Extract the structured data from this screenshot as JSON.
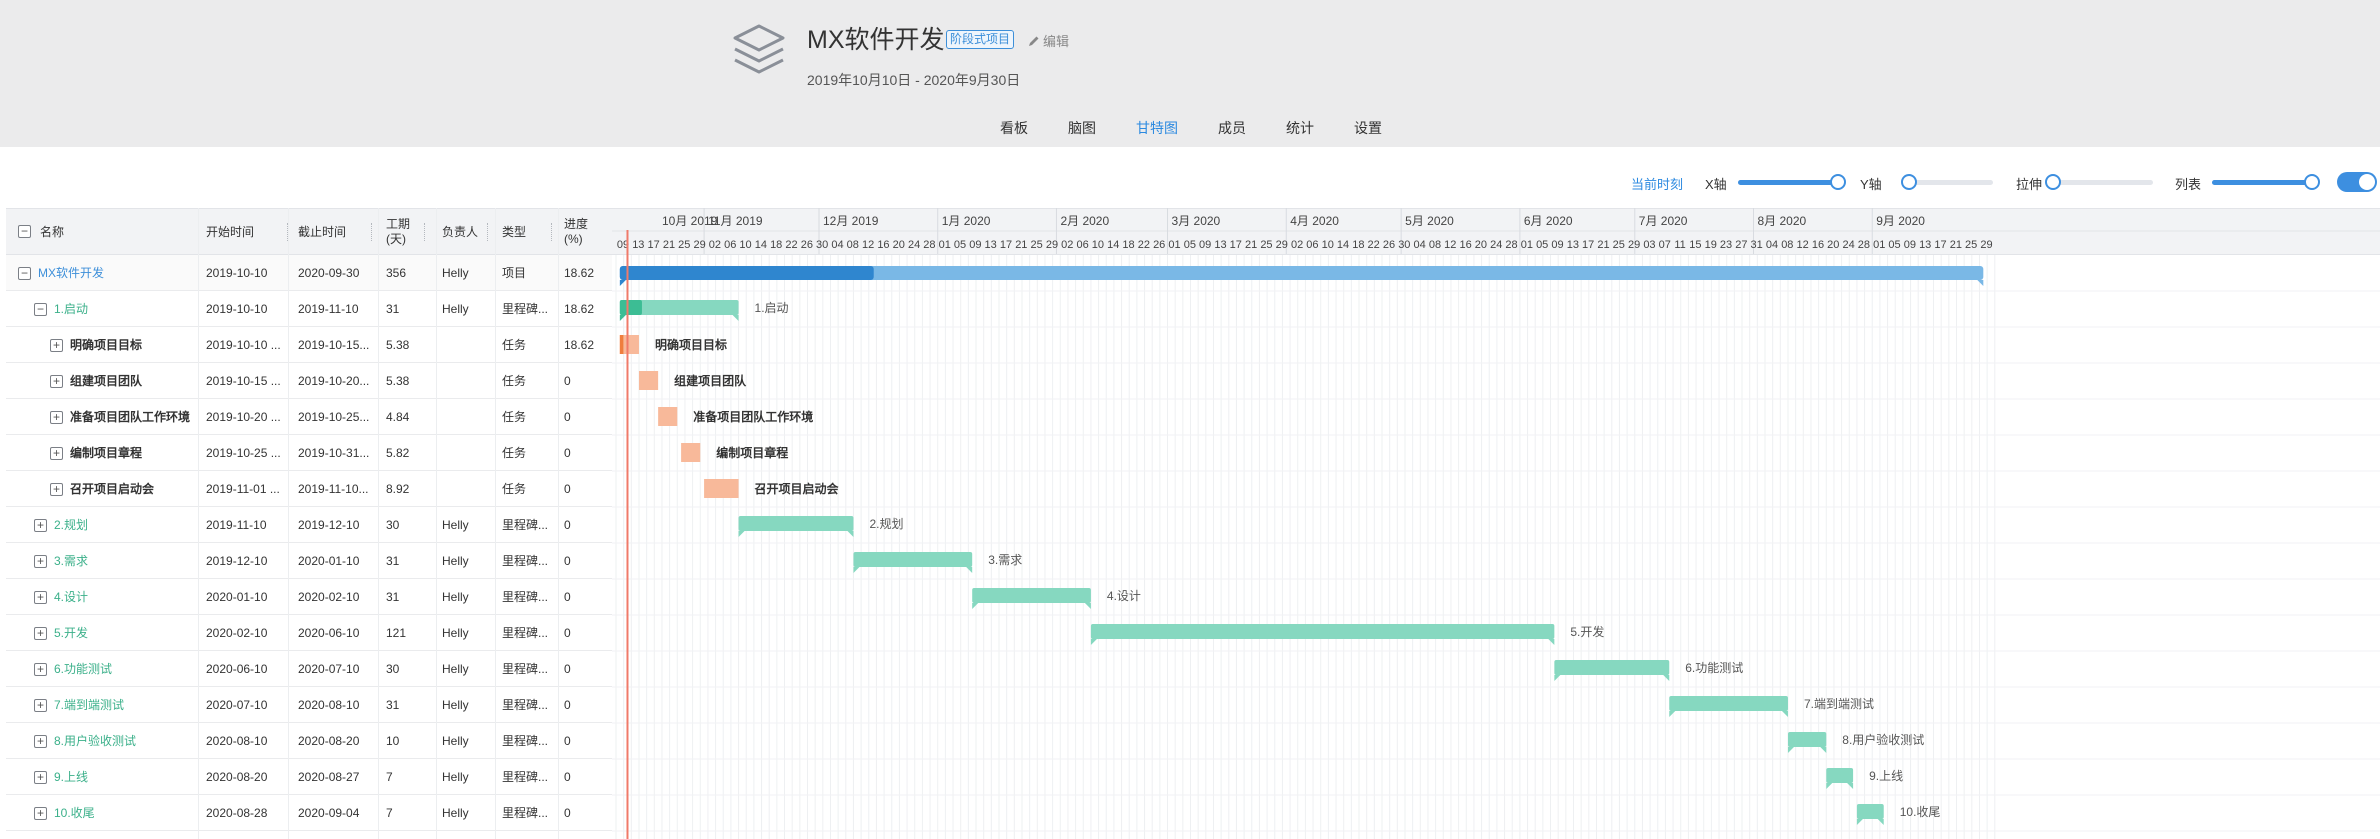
{
  "project": {
    "title": "MX软件开发",
    "tag": "阶段式项目",
    "edit_label": "编辑",
    "date_range": "2019年10月10日 - 2020年9月30日"
  },
  "tabs": [
    {
      "label": "看板",
      "active": false
    },
    {
      "label": "脑图",
      "active": false
    },
    {
      "label": "甘特图",
      "active": true
    },
    {
      "label": "成员",
      "active": false
    },
    {
      "label": "统计",
      "active": false
    },
    {
      "label": "设置",
      "active": false
    }
  ],
  "toolbar": {
    "now_label": "当前时刻",
    "x_axis_label": "X轴",
    "y_axis_label": "Y轴",
    "stretch_label": "拉伸",
    "list_label": "列表",
    "x_axis_level": 1.0,
    "y_axis_level": 0.0,
    "stretch_level": 0.0,
    "list_level": 1.0,
    "list_toggle_on": true
  },
  "colors": {
    "accent": "#2c8ae0",
    "project_bar": "#7ab8e6",
    "project_progress": "#2f86cf",
    "milestone_bar": "#86d8c0",
    "milestone_progress": "#3cbd94",
    "task_bar": "#f8b99a",
    "task_progress": "#ef7e3e",
    "today_line": "#f07a6a"
  },
  "columns": {
    "name": "名称",
    "start": "开始时间",
    "end": "截止时间",
    "duration": "工期(天)",
    "owner": "负责人",
    "type": "类型",
    "progress": "进度(%)"
  },
  "rows": [
    {
      "name": "MX软件开发",
      "start": "2019-10-10",
      "end": "2020-09-30",
      "duration": "356",
      "owner": "Helly",
      "type": "项目",
      "progress": "18.62",
      "kind": "project",
      "level": 0,
      "toggle": "−",
      "bar_start": "2019-10-10",
      "bar_end": "2020-09-30",
      "pct": 18.62
    },
    {
      "name": "1.启动",
      "start": "2019-10-10",
      "end": "2019-11-10",
      "duration": "31",
      "owner": "Helly",
      "type": "里程碑...",
      "progress": "18.62",
      "kind": "milestone",
      "level": 1,
      "toggle": "−",
      "bar_start": "2019-10-10",
      "bar_end": "2019-11-10",
      "pct": 18.62
    },
    {
      "name": "明确项目目标",
      "start": "2019-10-10 ...",
      "end": "2019-10-15...",
      "duration": "5.38",
      "owner": "",
      "type": "任务",
      "progress": "18.62",
      "kind": "task",
      "level": 2,
      "toggle": "+",
      "bar_start": "2019-10-10",
      "bar_end": "2019-10-15",
      "pct": 18.62
    },
    {
      "name": "组建项目团队",
      "start": "2019-10-15 ...",
      "end": "2019-10-20...",
      "duration": "5.38",
      "owner": "",
      "type": "任务",
      "progress": "0",
      "kind": "task",
      "level": 2,
      "toggle": "+",
      "bar_start": "2019-10-15",
      "bar_end": "2019-10-20",
      "pct": 0
    },
    {
      "name": "准备项目团队工作环境",
      "start": "2019-10-20 ...",
      "end": "2019-10-25...",
      "duration": "4.84",
      "owner": "",
      "type": "任务",
      "progress": "0",
      "kind": "task",
      "level": 2,
      "toggle": "+",
      "bar_start": "2019-10-20",
      "bar_end": "2019-10-25",
      "pct": 0
    },
    {
      "name": "编制项目章程",
      "start": "2019-10-25 ...",
      "end": "2019-10-31...",
      "duration": "5.82",
      "owner": "",
      "type": "任务",
      "progress": "0",
      "kind": "task",
      "level": 2,
      "toggle": "+",
      "bar_start": "2019-10-26",
      "bar_end": "2019-10-31",
      "pct": 0
    },
    {
      "name": "召开项目启动会",
      "start": "2019-11-01 ...",
      "end": "2019-11-10...",
      "duration": "8.92",
      "owner": "",
      "type": "任务",
      "progress": "0",
      "kind": "task",
      "level": 2,
      "toggle": "+",
      "bar_start": "2019-11-01",
      "bar_end": "2019-11-10",
      "pct": 0
    },
    {
      "name": "2.规划",
      "start": "2019-11-10",
      "end": "2019-12-10",
      "duration": "30",
      "owner": "Helly",
      "type": "里程碑...",
      "progress": "0",
      "kind": "milestone",
      "level": 1,
      "toggle": "+",
      "bar_start": "2019-11-10",
      "bar_end": "2019-12-10",
      "pct": 0
    },
    {
      "name": "3.需求",
      "start": "2019-12-10",
      "end": "2020-01-10",
      "duration": "31",
      "owner": "Helly",
      "type": "里程碑...",
      "progress": "0",
      "kind": "milestone",
      "level": 1,
      "toggle": "+",
      "bar_start": "2019-12-10",
      "bar_end": "2020-01-10",
      "pct": 0
    },
    {
      "name": "4.设计",
      "start": "2020-01-10",
      "end": "2020-02-10",
      "duration": "31",
      "owner": "Helly",
      "type": "里程碑...",
      "progress": "0",
      "kind": "milestone",
      "level": 1,
      "toggle": "+",
      "bar_start": "2020-01-10",
      "bar_end": "2020-02-10",
      "pct": 0
    },
    {
      "name": "5.开发",
      "start": "2020-02-10",
      "end": "2020-06-10",
      "duration": "121",
      "owner": "Helly",
      "type": "里程碑...",
      "progress": "0",
      "kind": "milestone",
      "level": 1,
      "toggle": "+",
      "bar_start": "2020-02-10",
      "bar_end": "2020-06-10",
      "pct": 0
    },
    {
      "name": "6.功能测试",
      "start": "2020-06-10",
      "end": "2020-07-10",
      "duration": "30",
      "owner": "Helly",
      "type": "里程碑...",
      "progress": "0",
      "kind": "milestone",
      "level": 1,
      "toggle": "+",
      "bar_start": "2020-06-10",
      "bar_end": "2020-07-10",
      "pct": 0
    },
    {
      "name": "7.端到端测试",
      "start": "2020-07-10",
      "end": "2020-08-10",
      "duration": "31",
      "owner": "Helly",
      "type": "里程碑...",
      "progress": "0",
      "kind": "milestone",
      "level": 1,
      "toggle": "+",
      "bar_start": "2020-07-10",
      "bar_end": "2020-08-10",
      "pct": 0
    },
    {
      "name": "8.用户验收测试",
      "start": "2020-08-10",
      "end": "2020-08-20",
      "duration": "10",
      "owner": "Helly",
      "type": "里程碑...",
      "progress": "0",
      "kind": "milestone",
      "level": 1,
      "toggle": "+",
      "bar_start": "2020-08-10",
      "bar_end": "2020-08-20",
      "pct": 0
    },
    {
      "name": "9.上线",
      "start": "2020-08-20",
      "end": "2020-08-27",
      "duration": "7",
      "owner": "Helly",
      "type": "里程碑...",
      "progress": "0",
      "kind": "milestone",
      "level": 1,
      "toggle": "+",
      "bar_start": "2020-08-20",
      "bar_end": "2020-08-27",
      "pct": 0
    },
    {
      "name": "10.收尾",
      "start": "2020-08-28",
      "end": "2020-09-04",
      "duration": "7",
      "owner": "Helly",
      "type": "里程碑...",
      "progress": "0",
      "kind": "milestone",
      "level": 1,
      "toggle": "+",
      "bar_start": "2020-08-28",
      "bar_end": "2020-09-04",
      "pct": 0
    }
  ],
  "timeline": {
    "today": "2019-10-12",
    "months": [
      {
        "label": "10月 2019",
        "date": "2019-10-01"
      },
      {
        "label": "11月 2019",
        "date": "2019-11-01"
      },
      {
        "label": "12月 2019",
        "date": "2019-12-01"
      },
      {
        "label": "1月 2020",
        "date": "2020-01-01"
      },
      {
        "label": "2月 2020",
        "date": "2020-02-01"
      },
      {
        "label": "3月 2020",
        "date": "2020-03-01"
      },
      {
        "label": "4月 2020",
        "date": "2020-04-01"
      },
      {
        "label": "5月 2020",
        "date": "2020-05-01"
      },
      {
        "label": "6月 2020",
        "date": "2020-06-01"
      },
      {
        "label": "7月 2020",
        "date": "2020-07-01"
      },
      {
        "label": "8月 2020",
        "date": "2020-08-01"
      },
      {
        "label": "9月 2020",
        "date": "2020-09-01"
      }
    ],
    "days": [
      {
        "label": "09",
        "date": "2019-10-09"
      },
      {
        "label": "13",
        "date": "2019-10-13"
      },
      {
        "label": "17",
        "date": "2019-10-17"
      },
      {
        "label": "21",
        "date": "2019-10-21"
      },
      {
        "label": "25",
        "date": "2019-10-25"
      },
      {
        "label": "29",
        "date": "2019-10-29"
      },
      {
        "label": "02",
        "date": "2019-11-02"
      },
      {
        "label": "06",
        "date": "2019-11-06"
      },
      {
        "label": "10",
        "date": "2019-11-10"
      },
      {
        "label": "14",
        "date": "2019-11-14"
      },
      {
        "label": "18",
        "date": "2019-11-18"
      },
      {
        "label": "22",
        "date": "2019-11-22"
      },
      {
        "label": "26",
        "date": "2019-11-26"
      },
      {
        "label": "30",
        "date": "2019-11-30"
      },
      {
        "label": "04",
        "date": "2019-12-04"
      },
      {
        "label": "08",
        "date": "2019-12-08"
      },
      {
        "label": "12",
        "date": "2019-12-12"
      },
      {
        "label": "16",
        "date": "2019-12-16"
      },
      {
        "label": "20",
        "date": "2019-12-20"
      },
      {
        "label": "24",
        "date": "2019-12-24"
      },
      {
        "label": "28",
        "date": "2019-12-28"
      },
      {
        "label": "01",
        "date": "2020-01-01"
      },
      {
        "label": "05",
        "date": "2020-01-05"
      },
      {
        "label": "09",
        "date": "2020-01-09"
      },
      {
        "label": "13",
        "date": "2020-01-13"
      },
      {
        "label": "17",
        "date": "2020-01-17"
      },
      {
        "label": "21",
        "date": "2020-01-21"
      },
      {
        "label": "25",
        "date": "2020-01-25"
      },
      {
        "label": "29",
        "date": "2020-01-29"
      },
      {
        "label": "02",
        "date": "2020-02-02"
      },
      {
        "label": "06",
        "date": "2020-02-06"
      },
      {
        "label": "10",
        "date": "2020-02-10"
      },
      {
        "label": "14",
        "date": "2020-02-14"
      },
      {
        "label": "18",
        "date": "2020-02-18"
      },
      {
        "label": "22",
        "date": "2020-02-22"
      },
      {
        "label": "26",
        "date": "2020-02-26"
      },
      {
        "label": "01",
        "date": "2020-03-01"
      },
      {
        "label": "05",
        "date": "2020-03-05"
      },
      {
        "label": "09",
        "date": "2020-03-09"
      },
      {
        "label": "13",
        "date": "2020-03-13"
      },
      {
        "label": "17",
        "date": "2020-03-17"
      },
      {
        "label": "21",
        "date": "2020-03-21"
      },
      {
        "label": "25",
        "date": "2020-03-25"
      },
      {
        "label": "29",
        "date": "2020-03-29"
      },
      {
        "label": "02",
        "date": "2020-04-02"
      },
      {
        "label": "06",
        "date": "2020-04-06"
      },
      {
        "label": "10",
        "date": "2020-04-10"
      },
      {
        "label": "14",
        "date": "2020-04-14"
      },
      {
        "label": "18",
        "date": "2020-04-18"
      },
      {
        "label": "22",
        "date": "2020-04-22"
      },
      {
        "label": "26",
        "date": "2020-04-26"
      },
      {
        "label": "30",
        "date": "2020-04-30"
      },
      {
        "label": "04",
        "date": "2020-05-04"
      },
      {
        "label": "08",
        "date": "2020-05-08"
      },
      {
        "label": "12",
        "date": "2020-05-12"
      },
      {
        "label": "16",
        "date": "2020-05-16"
      },
      {
        "label": "20",
        "date": "2020-05-20"
      },
      {
        "label": "24",
        "date": "2020-05-24"
      },
      {
        "label": "28",
        "date": "2020-05-28"
      },
      {
        "label": "01",
        "date": "2020-06-01"
      },
      {
        "label": "05",
        "date": "2020-06-05"
      },
      {
        "label": "09",
        "date": "2020-06-09"
      },
      {
        "label": "13",
        "date": "2020-06-13"
      },
      {
        "label": "17",
        "date": "2020-06-17"
      },
      {
        "label": "21",
        "date": "2020-06-21"
      },
      {
        "label": "25",
        "date": "2020-06-25"
      },
      {
        "label": "29",
        "date": "2020-06-29"
      },
      {
        "label": "03",
        "date": "2020-07-03"
      },
      {
        "label": "07",
        "date": "2020-07-07"
      },
      {
        "label": "11",
        "date": "2020-07-11"
      },
      {
        "label": "15",
        "date": "2020-07-15"
      },
      {
        "label": "19",
        "date": "2020-07-19"
      },
      {
        "label": "23",
        "date": "2020-07-23"
      },
      {
        "label": "27",
        "date": "2020-07-27"
      },
      {
        "label": "31",
        "date": "2020-07-31"
      },
      {
        "label": "04",
        "date": "2020-08-04"
      },
      {
        "label": "08",
        "date": "2020-08-08"
      },
      {
        "label": "12",
        "date": "2020-08-12"
      },
      {
        "label": "16",
        "date": "2020-08-16"
      },
      {
        "label": "20",
        "date": "2020-08-20"
      },
      {
        "label": "24",
        "date": "2020-08-24"
      },
      {
        "label": "28",
        "date": "2020-08-28"
      },
      {
        "label": "01",
        "date": "2020-09-01"
      },
      {
        "label": "05",
        "date": "2020-09-05"
      },
      {
        "label": "09",
        "date": "2020-09-09"
      },
      {
        "label": "13",
        "date": "2020-09-13"
      },
      {
        "label": "17",
        "date": "2020-09-17"
      },
      {
        "label": "21",
        "date": "2020-09-21"
      },
      {
        "label": "25",
        "date": "2020-09-25"
      },
      {
        "label": "29",
        "date": "2020-09-29"
      }
    ]
  }
}
